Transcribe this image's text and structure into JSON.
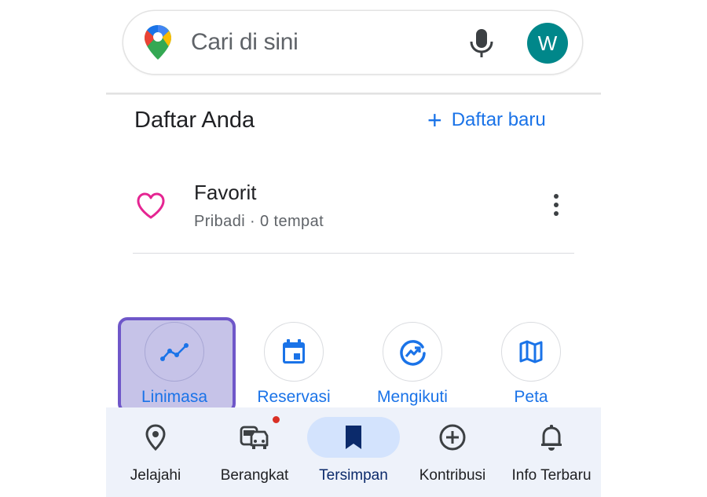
{
  "search": {
    "placeholder": "Cari di sini",
    "avatar_initial": "W",
    "avatar_color": "#00878a"
  },
  "lists_section": {
    "title": "Daftar Anda",
    "new_list_label": "Daftar baru"
  },
  "lists": [
    {
      "name": "Favorit",
      "subtitle": "Pribadi · 0 tempat",
      "icon": "heart-icon",
      "icon_color": "#e52592"
    }
  ],
  "shortcuts": [
    {
      "label": "Linimasa",
      "icon": "timeline-icon",
      "selected": true
    },
    {
      "label": "Reservasi",
      "icon": "calendar-icon",
      "selected": false
    },
    {
      "label": "Mengikuti",
      "icon": "following-icon",
      "selected": false
    },
    {
      "label": "Peta",
      "icon": "map-icon",
      "selected": false
    }
  ],
  "bottom_nav": [
    {
      "label": "Jelajahi",
      "icon": "location-pin-icon",
      "active": false
    },
    {
      "label": "Berangkat",
      "icon": "commute-icon",
      "active": false,
      "badge": true
    },
    {
      "label": "Tersimpan",
      "icon": "bookmark-icon",
      "active": true
    },
    {
      "label": "Kontribusi",
      "icon": "add-circle-icon",
      "active": false
    },
    {
      "label": "Info Terbaru",
      "icon": "bell-icon",
      "active": false
    }
  ],
  "colors": {
    "accent": "#1a73e8",
    "nav_background": "#eef2fa",
    "nav_active_pill": "#d3e3fd",
    "selection_fill": "#c6c3e8",
    "selection_border": "#6f57c9"
  }
}
